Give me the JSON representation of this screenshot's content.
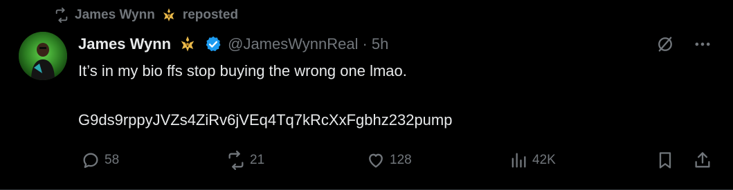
{
  "repost": {
    "user": "James Wynn",
    "label": "reposted",
    "icon": "repost-icon",
    "badge_icon": "affiliate-badge-icon"
  },
  "tweet": {
    "author_name": "James Wynn",
    "handle": "@JamesWynnReal",
    "separator": "·",
    "time": "5h",
    "text_line1": "It’s in my bio ffs stop buying the wrong one lmao.",
    "text_line2": "G9ds9rppyJVZs4ZiRv6jVEq4Tq7kRcXxFgbhz232pump"
  },
  "top_actions": {
    "grok_icon": "grok-icon",
    "more_icon": "more-icon"
  },
  "stats": {
    "replies": "58",
    "reposts": "21",
    "likes": "128",
    "views": "42K"
  },
  "colors": {
    "background": "#000000",
    "text": "#e7e9ea",
    "muted": "#71767b",
    "verified": "#1d9bf0",
    "badge": "#e8b84a"
  }
}
